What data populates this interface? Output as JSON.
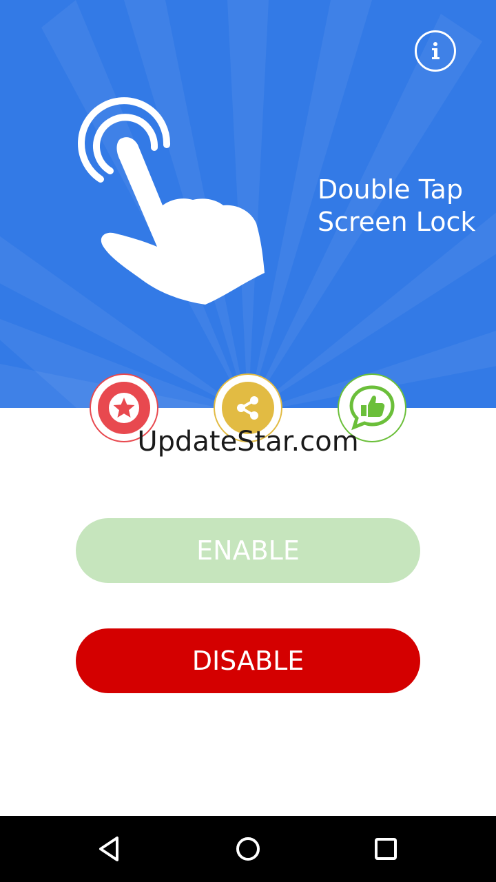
{
  "app": {
    "title_line1": "Double Tap",
    "title_line2": "Screen Lock"
  },
  "colors": {
    "hero": "#337ae6",
    "rate": "#e8494f",
    "share": "#e2bb43",
    "like": "#6bbf3a",
    "enable": "#c6e5bd",
    "disable": "#d40000"
  },
  "icons": {
    "info": "info-icon",
    "hero": "double-tap-hand-icon",
    "rate": "star-icon",
    "share": "share-icon",
    "like": "thumbs-up-chat-icon"
  },
  "watermark": "UpdateStar.com",
  "buttons": {
    "enable": "ENABLE",
    "disable": "DISABLE"
  },
  "navbar": {
    "back": "back-icon",
    "home": "home-icon",
    "recents": "recents-icon"
  }
}
